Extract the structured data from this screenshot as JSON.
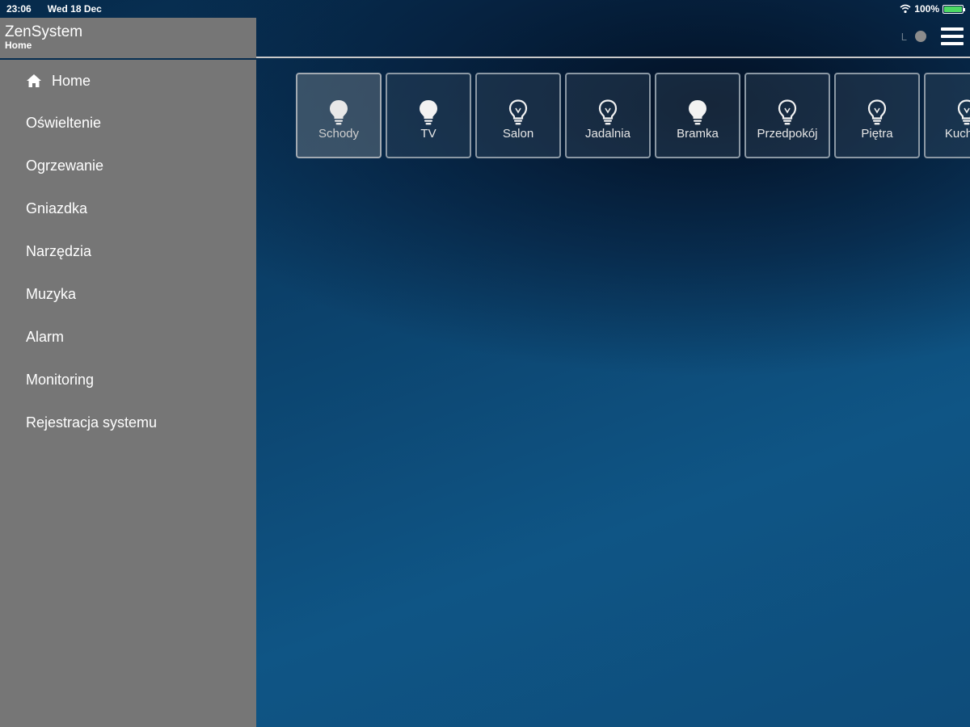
{
  "status_bar": {
    "time": "23:06",
    "date": "Wed 18 Dec",
    "battery": "100%"
  },
  "header": {
    "title": "ZenSystem",
    "subtitle": "Home",
    "indicator_label": "L"
  },
  "sidebar": {
    "items": [
      {
        "label": "Home",
        "icon": "home-icon"
      },
      {
        "label": "Oświeltenie"
      },
      {
        "label": "Ogrzewanie"
      },
      {
        "label": "Gniazdka"
      },
      {
        "label": "Narzędzia"
      },
      {
        "label": "Muzyka"
      },
      {
        "label": "Alarm"
      },
      {
        "label": "Monitoring"
      },
      {
        "label": "Rejestracja systemu"
      }
    ]
  },
  "tiles": [
    {
      "label": "Schody",
      "icon": "lightbulb-filled-icon",
      "state": "active"
    },
    {
      "label": "TV",
      "icon": "lightbulb-filled-icon"
    },
    {
      "label": "Salon",
      "icon": "lightbulb-outline-icon"
    },
    {
      "label": "Jadalnia",
      "icon": "lightbulb-outline-icon"
    },
    {
      "label": "Bramka",
      "icon": "lightbulb-filled-icon"
    },
    {
      "label": "Przedpokój",
      "icon": "lightbulb-outline-icon"
    },
    {
      "label": "Piętra",
      "icon": "lightbulb-outline-icon"
    },
    {
      "label": "Kuchnia",
      "icon": "lightbulb-outline-icon"
    }
  ],
  "colors": {
    "sidebar_bg": "#767676",
    "battery_green": "#4cd964",
    "tile_border": "#8b98a4"
  }
}
